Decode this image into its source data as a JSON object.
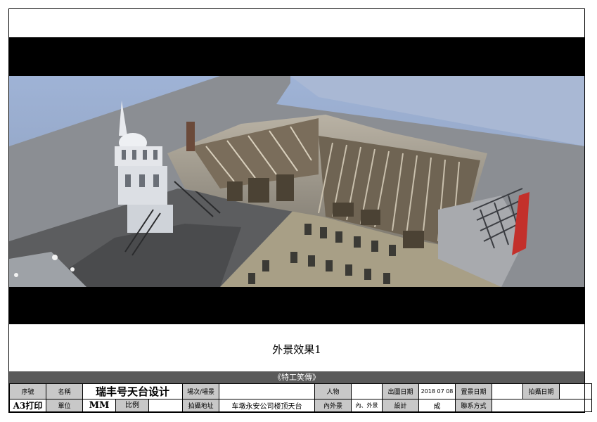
{
  "caption": "外景效果1",
  "production_title": "《特工笑傳》",
  "info": {
    "serial_label": "序號",
    "name_label": "名稱",
    "name_value": "瑞丰号天台设计",
    "scene_label": "場次/場景",
    "scene_value": "",
    "character_label": "人物",
    "character_value": "",
    "drawing_date_label": "出圖日期",
    "drawing_date_value": "2018 07 08",
    "set_date_label": "置景日期",
    "set_date_value": "",
    "shoot_date_label": "拍攝日期",
    "shoot_date_value": "",
    "print_value": "A3打印",
    "unit_label": "單位",
    "unit_value": "MM",
    "scale_label": "比例",
    "scale_value": "",
    "location_label": "拍攝地址",
    "location_value": "车墩永安公司楼顶天台",
    "int_ext_label": "內外景",
    "int_ext_value": "內、外景",
    "design_label": "設計",
    "design_value": "成",
    "contact_label": "聯系方式",
    "contact_value": ""
  },
  "colors": {
    "sky": "#8fa3c4",
    "ground": "#8a8d92",
    "band": "#000000",
    "title_bar": "#5a5a5a",
    "label_cell": "#c8c8c8"
  }
}
